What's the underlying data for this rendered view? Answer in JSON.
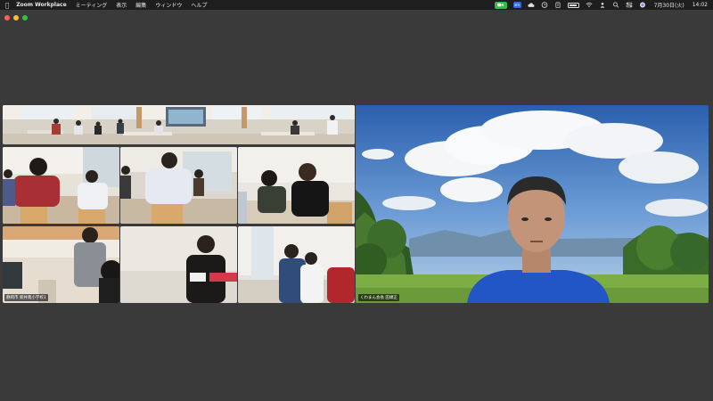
{
  "menubar": {
    "apple_icon": "apple-logo-icon",
    "app_name": "Zoom Workplace",
    "menus": [
      "ミーティング",
      "表示",
      "編集",
      "ウィンドウ",
      "ヘルプ"
    ],
    "date": "7月30日(火)",
    "time": "14:02",
    "colors": {
      "zoom_status": "#2bbf4a",
      "zoom_badge": "#2d6cdf"
    }
  },
  "window": {
    "controls": [
      "close",
      "minimize",
      "maximize"
    ]
  },
  "gallery": {
    "tiles": [
      {
        "id": 1,
        "name": ""
      },
      {
        "id": 2,
        "name": ""
      },
      {
        "id": 3,
        "name": ""
      },
      {
        "id": 4,
        "name": ""
      },
      {
        "id": 5,
        "name": ""
      },
      {
        "id": 6,
        "name": "静岡市 新井南小学校1"
      },
      {
        "id": 7,
        "name": ""
      },
      {
        "id": 8,
        "name": ""
      }
    ]
  },
  "speaker": {
    "name": "くわまん会長 田頭正"
  }
}
